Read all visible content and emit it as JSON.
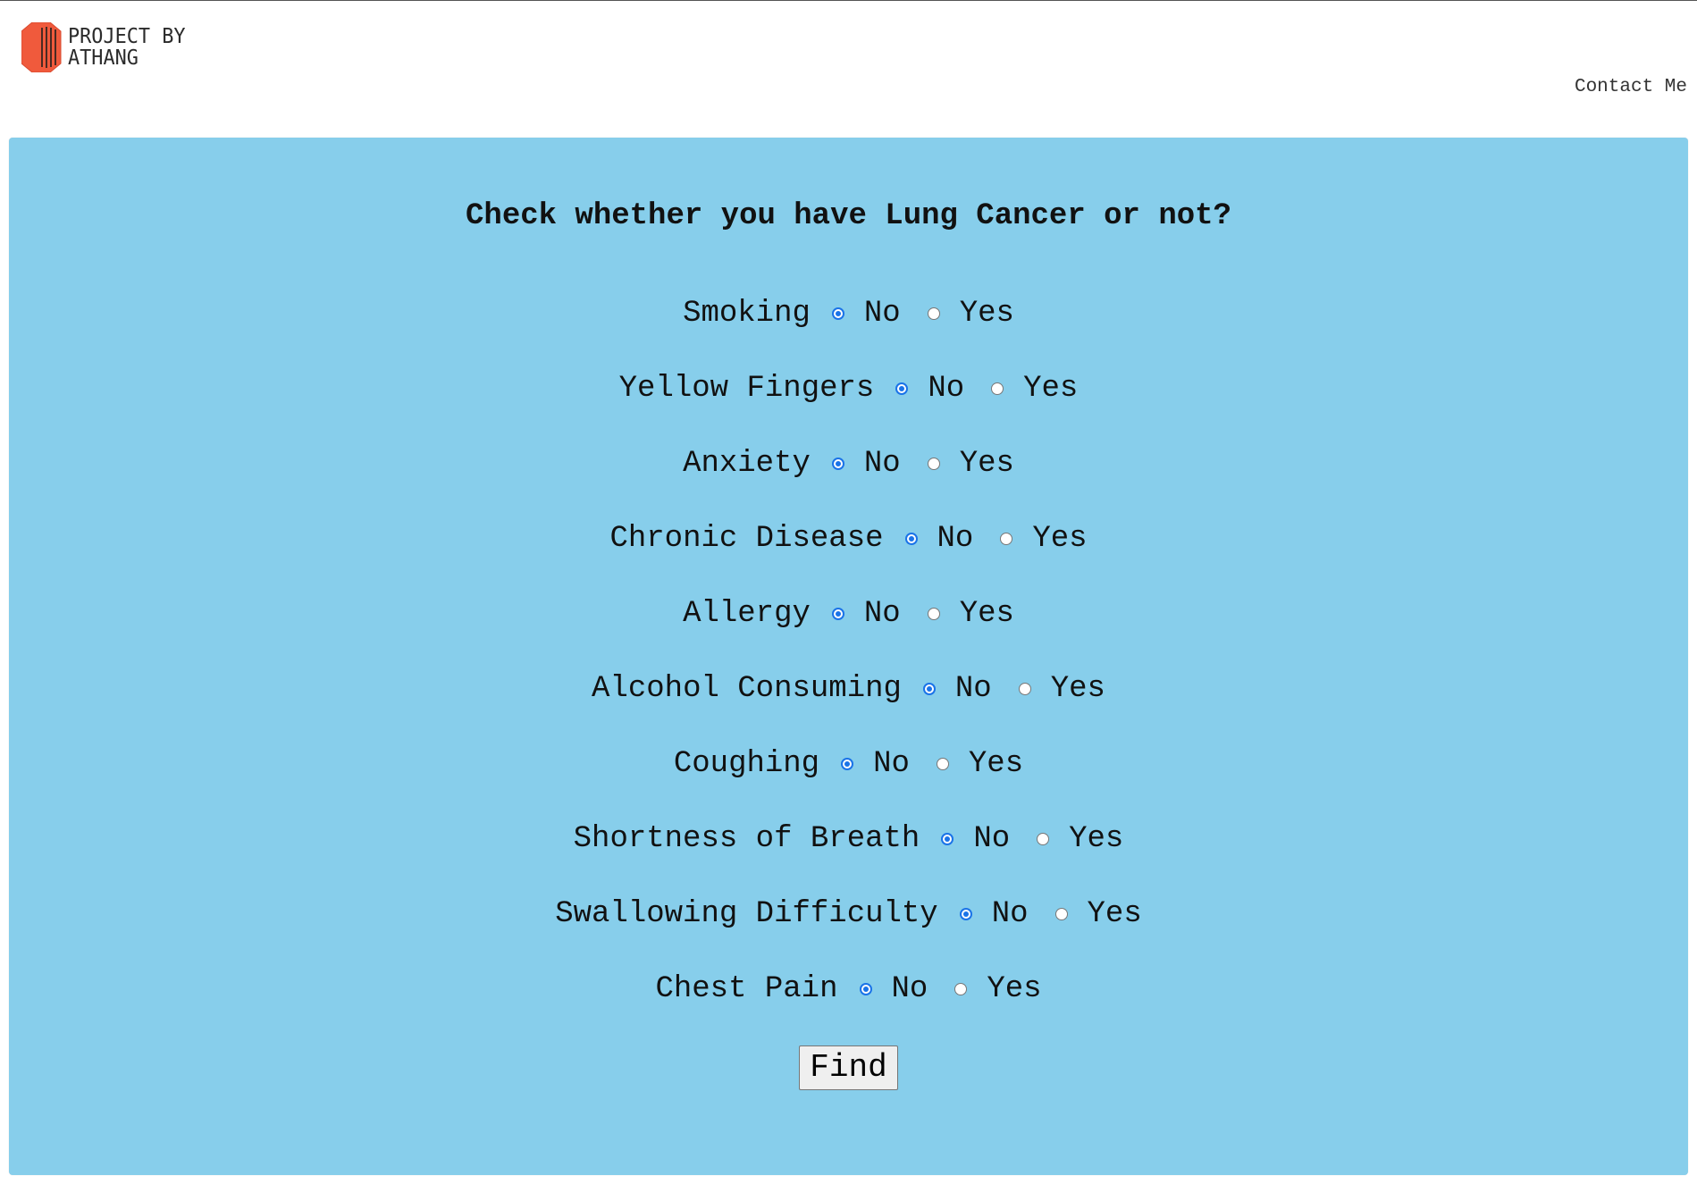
{
  "header": {
    "logo_line1": "PROJECT BY",
    "logo_line2": "ATHANG",
    "contact_label": "Contact Me"
  },
  "form": {
    "title": "Check whether you have Lung Cancer or not?",
    "option_no": "No",
    "option_yes": "Yes",
    "questions": [
      {
        "label": "Smoking",
        "selected": "No"
      },
      {
        "label": "Yellow Fingers",
        "selected": "No"
      },
      {
        "label": "Anxiety",
        "selected": "No"
      },
      {
        "label": "Chronic Disease",
        "selected": "No"
      },
      {
        "label": "Allergy",
        "selected": "No"
      },
      {
        "label": "Alcohol Consuming",
        "selected": "No"
      },
      {
        "label": "Coughing",
        "selected": "No"
      },
      {
        "label": "Shortness of Breath",
        "selected": "No"
      },
      {
        "label": "Swallowing Difficulty",
        "selected": "No"
      },
      {
        "label": "Chest Pain",
        "selected": "No"
      }
    ],
    "submit_label": "Find"
  },
  "colors": {
    "panel_background": "#87ceeb",
    "logo_accent": "#f05a3c",
    "radio_selected": "#1a73e8"
  },
  "icons": {
    "logo": "orange-hexagon-logo-icon"
  }
}
